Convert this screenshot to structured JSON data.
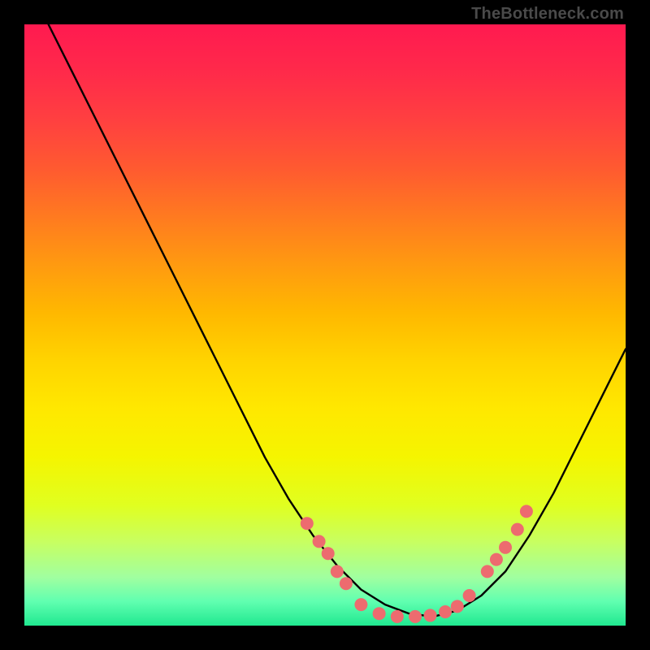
{
  "watermark": "TheBottleneck.com",
  "chart_data": {
    "type": "line",
    "title": "",
    "xlabel": "",
    "ylabel": "",
    "xlim": [
      0,
      100
    ],
    "ylim": [
      0,
      100
    ],
    "grid": false,
    "legend": false,
    "series": [
      {
        "name": "curve",
        "x": [
          4,
          8,
          12,
          16,
          20,
          24,
          28,
          32,
          36,
          40,
          44,
          48,
          52,
          56,
          60,
          64,
          68,
          72,
          76,
          80,
          84,
          88,
          92,
          96,
          100
        ],
        "y": [
          100,
          92,
          84,
          76,
          68,
          60,
          52,
          44,
          36,
          28,
          21,
          15,
          10,
          6,
          3.5,
          2,
          1.5,
          2.5,
          5,
          9,
          15,
          22,
          30,
          38,
          46
        ]
      }
    ],
    "markers": {
      "name": "dots",
      "color": "#ed6b6f",
      "radius": 8,
      "points": [
        {
          "x": 47,
          "y": 17
        },
        {
          "x": 49,
          "y": 14
        },
        {
          "x": 50.5,
          "y": 12
        },
        {
          "x": 52,
          "y": 9
        },
        {
          "x": 53.5,
          "y": 7
        },
        {
          "x": 56,
          "y": 3.5
        },
        {
          "x": 59,
          "y": 2
        },
        {
          "x": 62,
          "y": 1.5
        },
        {
          "x": 65,
          "y": 1.5
        },
        {
          "x": 67.5,
          "y": 1.7
        },
        {
          "x": 70,
          "y": 2.3
        },
        {
          "x": 72,
          "y": 3.2
        },
        {
          "x": 74,
          "y": 5
        },
        {
          "x": 77,
          "y": 9
        },
        {
          "x": 78.5,
          "y": 11
        },
        {
          "x": 80,
          "y": 13
        },
        {
          "x": 82,
          "y": 16
        },
        {
          "x": 83.5,
          "y": 19
        }
      ]
    }
  }
}
